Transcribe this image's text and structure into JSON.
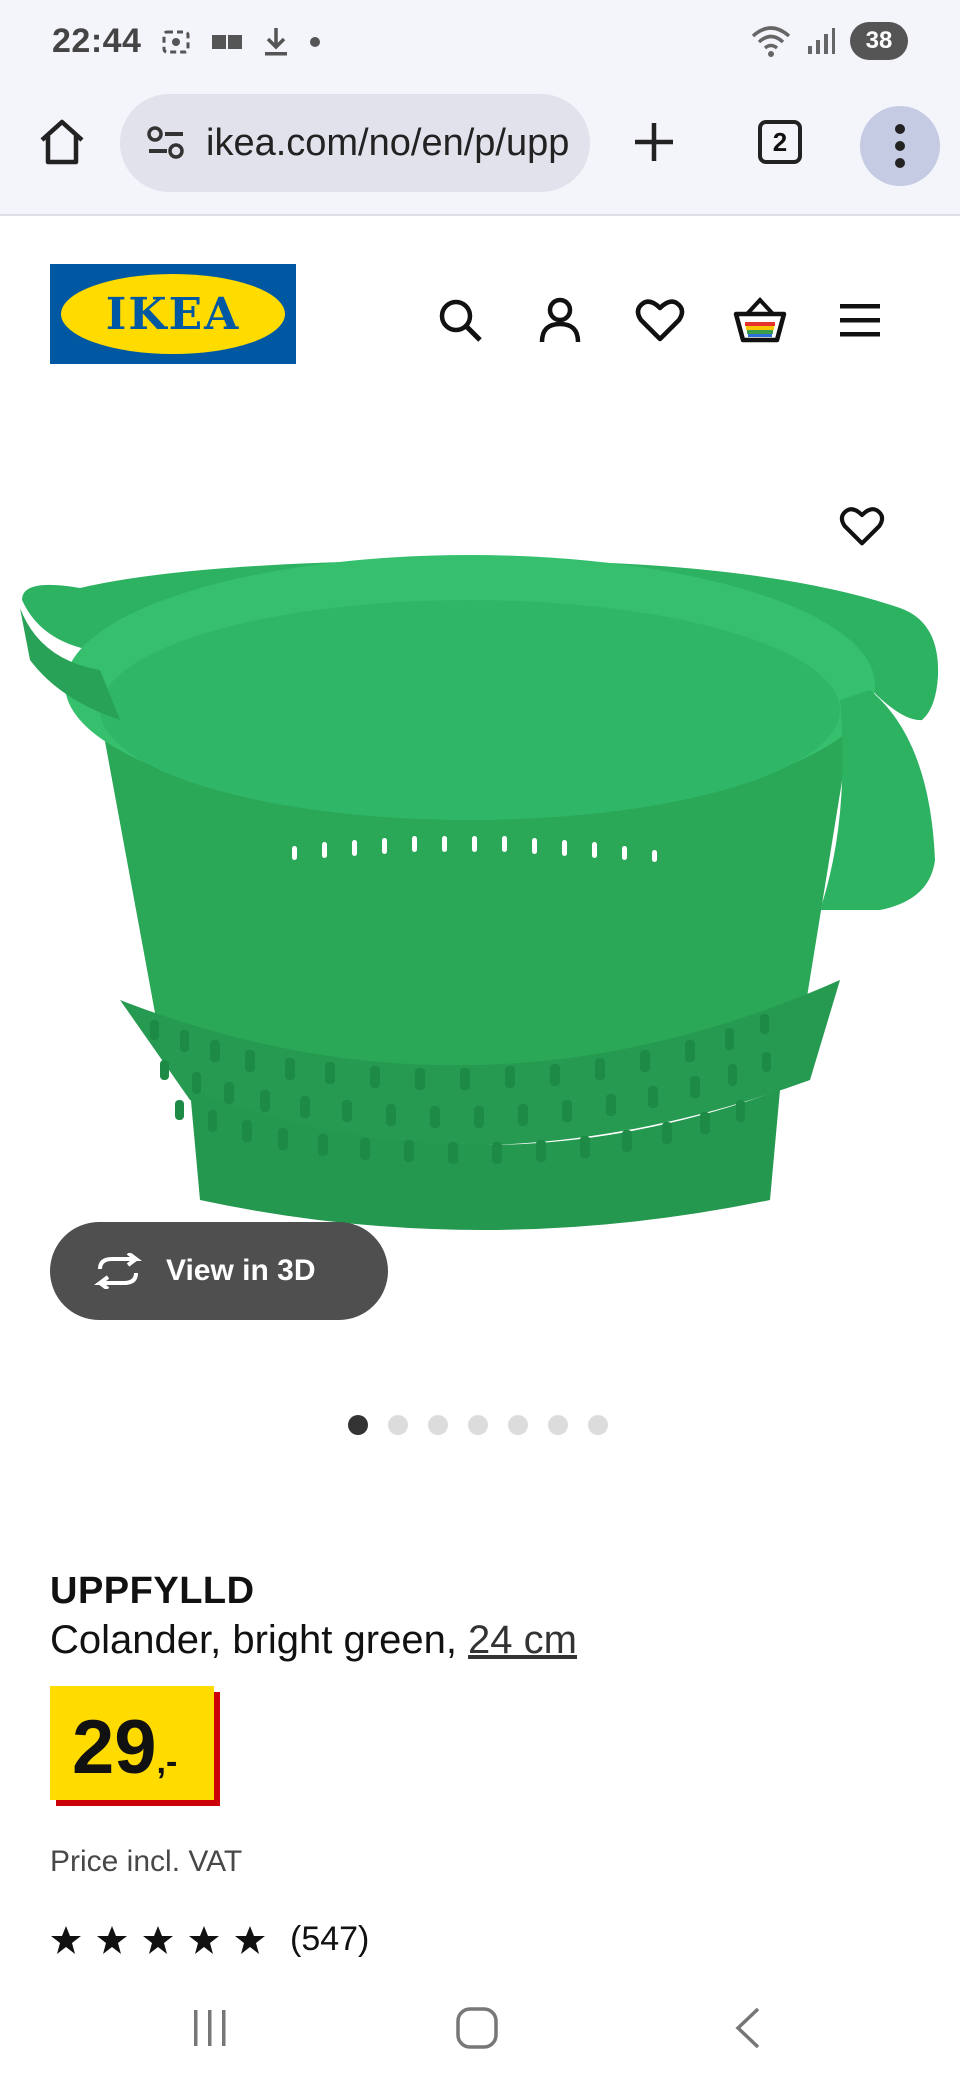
{
  "status_bar": {
    "time": "22:44",
    "battery": "38",
    "signal_label": "5"
  },
  "browser": {
    "url": "ikea.com/no/en/p/upp",
    "tab_count": "2"
  },
  "site": {
    "logo_text": "IKEA"
  },
  "gallery": {
    "view_3d_label": "View in 3D",
    "dot_count": 7,
    "active_dot": 0
  },
  "product": {
    "name": "UPPFYLLD",
    "description": "Colander, bright green, ",
    "size": "24 cm",
    "price_int": "29",
    "price_dec": ",-",
    "price_note": "Price incl. VAT",
    "rating": 5,
    "review_count": "(547)"
  },
  "colors": {
    "product_green": "#2fb360",
    "ikea_blue": "#0058a3",
    "ikea_yellow": "#ffdb00",
    "price_red": "#cc0008"
  }
}
